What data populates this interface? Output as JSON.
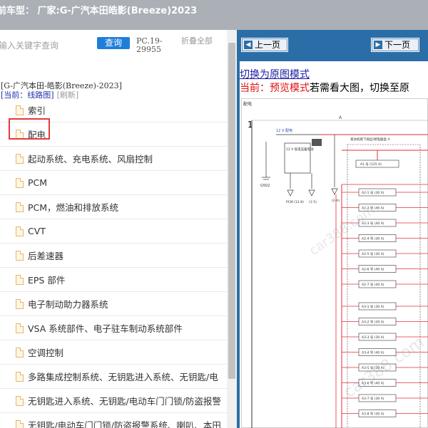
{
  "header": {
    "title": "前车型： 厂家:G-广汽本田皓影(Breeze)2023"
  },
  "search": {
    "placeholder": "输入关键字查询",
    "button": "查询",
    "pc_code": "PC.19-29955",
    "collapse": "折叠全部"
  },
  "tree": {
    "breadcrumb": "[G-广汽本田-皓影(Breeze)-2023]",
    "current_label": "[当前：线路图]",
    "refresh_label": "[刷新]",
    "items": [
      {
        "label": "索引"
      },
      {
        "label": "配电"
      },
      {
        "label": "起动系统、充电系统、风扇控制"
      },
      {
        "label": "PCM"
      },
      {
        "label": "PCM，燃油和排放系统"
      },
      {
        "label": "CVT"
      },
      {
        "label": "后差速器"
      },
      {
        "label": "EPS 部件"
      },
      {
        "label": "电子制动助力器系统"
      },
      {
        "label": "VSA 系统部件、电子驻车制动系统部件"
      },
      {
        "label": "空调控制"
      },
      {
        "label": "多路集成控制系统、无钥匙进入系统、无钥匙/电"
      },
      {
        "label": "无钥匙进入系统、无钥匙/电动车门门锁/防盗报警"
      },
      {
        "label": "无钥匙/电动车门门锁/防盗报警系统、喇叭、本田"
      }
    ]
  },
  "viewer": {
    "prev_label": "上一页",
    "next_label": "下一页",
    "mode_link": "切换为原图模式",
    "mode_status_red": "当前：预览模式",
    "mode_status_rest": "若需看大图，切换至原",
    "diagram": {
      "title": "配电",
      "page_no": "1",
      "col_label": "A",
      "top_label": "12 V 配电",
      "battery_label": "12 V 低电压蓄电池",
      "ground_label": "G502",
      "fuse_main": "A1 号 (125 A)",
      "fuse_box_label": "发动机舱下熔丝/继电器盒 A",
      "fuse_list": [
        "A2-1 号 (30 A)",
        "A2-2 号 (40 A)",
        "A2-3 号 (40 A)",
        "A2-4 号 (30 A)",
        "A2-5 号 (30 A)",
        "A2-6 号 (40 A)",
        "A2-7 号 (40 A)"
      ],
      "fuse_list2": [
        "A3-1 号 (30 A)",
        "A3-2 号 (30 A)",
        "A3-3 号 (30 A)",
        "A3-4 号 (40 A)",
        "A3-5 号 (30 A)",
        "A3-6 号 (40 A)",
        "A3-7 号 (30 A)",
        "A3-8 号 (30 A)"
      ],
      "watermark": "car388.com",
      "connector_labels": [
        "PCM (12-8)",
        "(1-5)",
        "(2-A)"
      ]
    }
  },
  "colors": {
    "accent": "#2b6ea7",
    "highlight": "#e23b3b",
    "red_text": "#e01010",
    "wire_red": "#e0303a",
    "link": "#1a1aa6"
  }
}
